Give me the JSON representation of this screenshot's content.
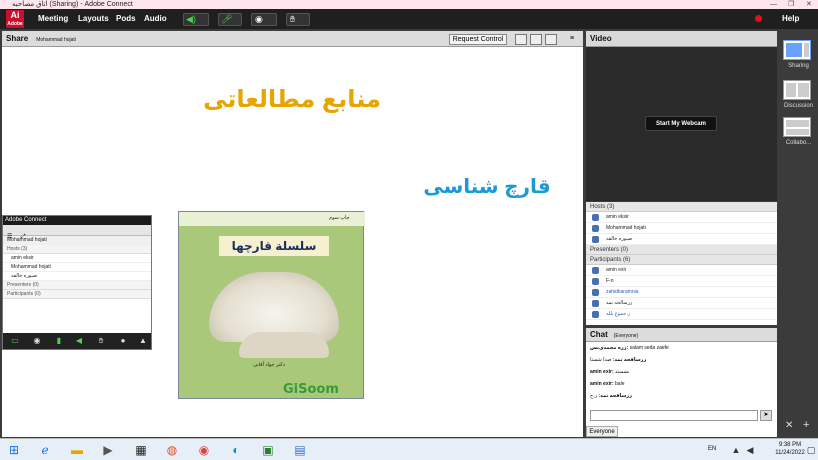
{
  "window": {
    "title": "اتاق مصاحبه (Sharing) - Adobe Connect",
    "controls": [
      "—",
      "❐",
      "✕"
    ]
  },
  "logo": {
    "text": "Ai",
    "sub": "Adobe"
  },
  "menu": {
    "items": [
      "Meeting",
      "Layouts",
      "Pods",
      "Audio"
    ],
    "help": "Help"
  },
  "share_pod": {
    "title": "Share",
    "presenter": "Mohammad hojati",
    "request_control": "Request Control",
    "slide": {
      "title": "منابع مطالعاتی",
      "subtitle": "قارچ شناسی",
      "book": {
        "title": "سلسلة قارچها",
        "badge": "چاپ سوم",
        "author": "دکتر جواد آقایی",
        "brand": "GiSoom"
      }
    },
    "colors": {
      "title": "#e8a400",
      "subtitle": "#1a9ad8"
    }
  },
  "mini_panel": {
    "title": "Adobe Connect",
    "presenter": "Mohammad hojati",
    "sections": {
      "hosts": "Hosts (3)",
      "presenters": "Presenters (0)",
      "participants": "Participants (0)"
    },
    "hosts": [
      "amin eksir",
      "Mohammad hojati",
      "صبوره خالقه"
    ]
  },
  "video_pod": {
    "title": "Video",
    "webcam_button": "Start My Webcam"
  },
  "attendees": {
    "hosts_label": "Hosts (3)",
    "hosts": [
      "amin eksir",
      "Mohammad hojati",
      "صبوره خالقه"
    ],
    "presenters_label": "Presenters (0)",
    "participants_label": "Participants (6)",
    "participants": [
      "amin exir",
      "F-n",
      "zahidkaramnia",
      "زرسالحه تمد",
      "ر.جموع بلله"
    ]
  },
  "chat": {
    "title": "Chat",
    "scope": "(Everyone)",
    "messages": [
      {
        "who": "زره محمدی‌نس:",
        "text": "salam seda zaefe"
      },
      {
        "who": "زرساقحه تمد:",
        "text": "صدا شستا"
      },
      {
        "who": "amin exir:",
        "text": "نشستد"
      },
      {
        "who": "amin exir:",
        "text": "bale"
      },
      {
        "who": "زرساقحه تمد:",
        "text": "ز.ح"
      }
    ],
    "to": "Everyone"
  },
  "layouts": [
    {
      "label": "Sharing"
    },
    {
      "label": "Discussion"
    },
    {
      "label": "Collabo..."
    }
  ],
  "taskbar": {
    "lang": "EN",
    "time": "9:38 PM",
    "date": "11/24/2022"
  }
}
